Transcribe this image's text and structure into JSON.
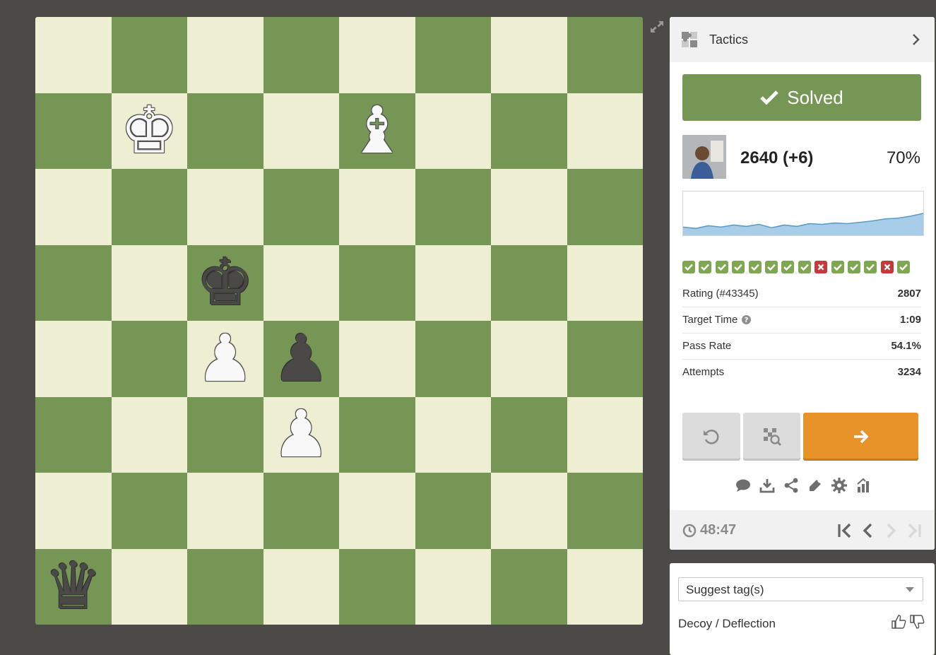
{
  "board": {
    "light_color": "#eeeed2",
    "dark_color": "#769656",
    "pieces": [
      {
        "square": "b7",
        "color": "white",
        "type": "king",
        "glyph": "♚"
      },
      {
        "square": "e7",
        "color": "white",
        "type": "bishop",
        "glyph": "♝"
      },
      {
        "square": "c5",
        "color": "black",
        "type": "king",
        "glyph": "♚"
      },
      {
        "square": "c4",
        "color": "white",
        "type": "pawn",
        "glyph": "♟"
      },
      {
        "square": "d4",
        "color": "black",
        "type": "pawn",
        "glyph": "♟"
      },
      {
        "square": "d3",
        "color": "white",
        "type": "pawn",
        "glyph": "♟"
      },
      {
        "square": "a1",
        "color": "black",
        "type": "queen",
        "glyph": "♛"
      }
    ]
  },
  "panel": {
    "title": "Tactics",
    "status": "Solved",
    "rating": "2640 (+6)",
    "percent": "70%",
    "history": [
      "pass",
      "pass",
      "pass",
      "pass",
      "pass",
      "pass",
      "pass",
      "pass",
      "fail",
      "pass",
      "pass",
      "pass",
      "fail",
      "pass"
    ],
    "stats": [
      {
        "label": "Rating (#43345)",
        "value": "2807"
      },
      {
        "label": "Target Time",
        "value": "1:09",
        "help": true
      },
      {
        "label": "Pass Rate",
        "value": "54.1%"
      },
      {
        "label": "Attempts",
        "value": "3234"
      }
    ],
    "timer": "48:47",
    "accent_color": "#769656",
    "next_color": "#e8922a"
  },
  "tags": {
    "select_placeholder": "Suggest tag(s)",
    "items": [
      {
        "name": "Decoy / Deflection"
      }
    ]
  }
}
